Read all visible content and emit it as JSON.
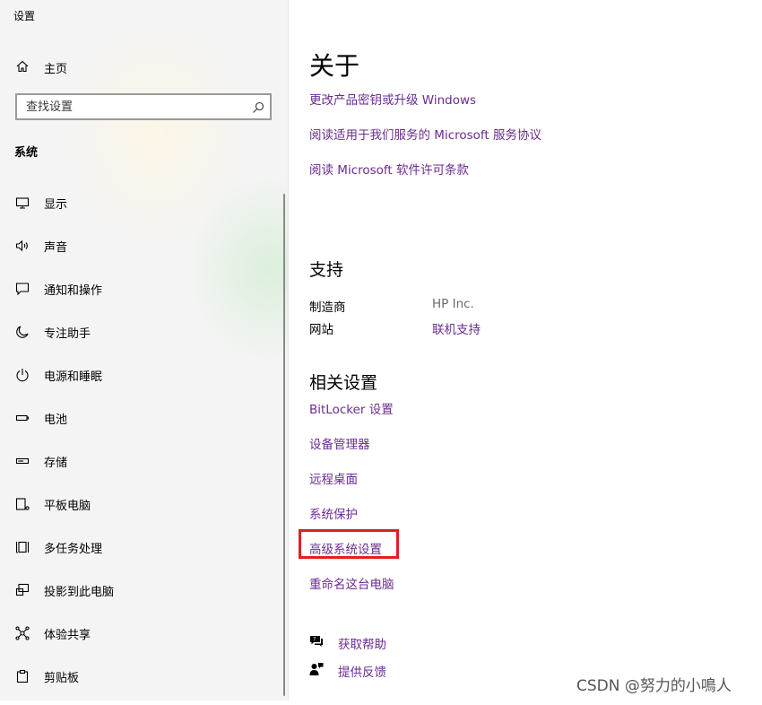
{
  "window": {
    "title": "设置"
  },
  "sidebar": {
    "home": {
      "label": "主页",
      "icon": "home-icon"
    },
    "search": {
      "placeholder": "查找设置",
      "icon": "search-icon"
    },
    "section_title": "系统",
    "items": [
      {
        "label": "显示",
        "icon": "display-icon"
      },
      {
        "label": "声音",
        "icon": "speaker-icon"
      },
      {
        "label": "通知和操作",
        "icon": "message-icon"
      },
      {
        "label": "专注助手",
        "icon": "moon-icon"
      },
      {
        "label": "电源和睡眠",
        "icon": "power-icon"
      },
      {
        "label": "电池",
        "icon": "battery-icon"
      },
      {
        "label": "存储",
        "icon": "storage-icon"
      },
      {
        "label": "平板电脑",
        "icon": "tablet-icon"
      },
      {
        "label": "多任务处理",
        "icon": "multitask-icon"
      },
      {
        "label": "投影到此电脑",
        "icon": "project-icon"
      },
      {
        "label": "体验共享",
        "icon": "share-icon"
      },
      {
        "label": "剪贴板",
        "icon": "clipboard-icon"
      }
    ]
  },
  "main": {
    "about": {
      "title": "关于",
      "links": [
        "更改产品密钥或升级 Windows",
        "阅读适用于我们服务的 Microsoft 服务协议",
        "阅读 Microsoft 软件许可条款"
      ]
    },
    "support": {
      "title": "支持",
      "manufacturer_label": "制造商",
      "manufacturer_value": "HP Inc.",
      "website_label": "网站",
      "website_value": "联机支持"
    },
    "related": {
      "title": "相关设置",
      "links": [
        "BitLocker 设置",
        "设备管理器",
        "远程桌面",
        "系统保护",
        "高级系统设置",
        "重命名这台电脑"
      ]
    },
    "help": {
      "get_help": "获取帮助",
      "feedback": "提供反馈"
    }
  },
  "colors": {
    "link": "#6b2c91",
    "highlight": "#e02020",
    "sidebar_bg": "#f4f4f4"
  },
  "watermark": "CSDN @努力的小鳴人"
}
